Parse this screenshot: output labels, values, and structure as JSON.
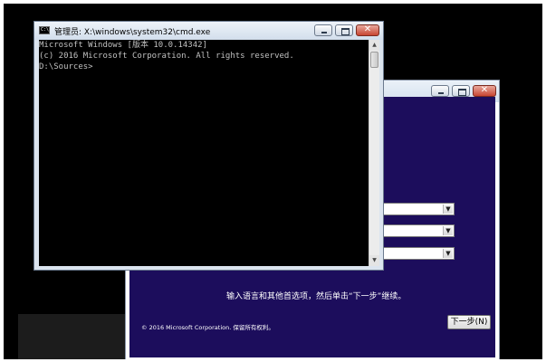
{
  "cmd": {
    "title": "管理员: X:\\windows\\system32\\cmd.exe",
    "icon_label": "C:\\",
    "console_lines": [
      "Microsoft Windows [版本 10.0.14342]",
      "(c) 2016 Microsoft Corporation. All rights reserved.",
      "",
      "D:\\Sources>"
    ],
    "controls": [
      "minimize-icon",
      "maximize-icon",
      "close-icon"
    ]
  },
  "setup": {
    "instruction": "输入语言和其他首选项，然后单击“下一步”继续。",
    "copyright": "© 2016 Microsoft Corporation. 保留所有权利。",
    "next_button": "下一步(N)",
    "dropdowns": [
      "",
      "",
      ""
    ],
    "colors": {
      "background": "#1c0d5c"
    }
  }
}
